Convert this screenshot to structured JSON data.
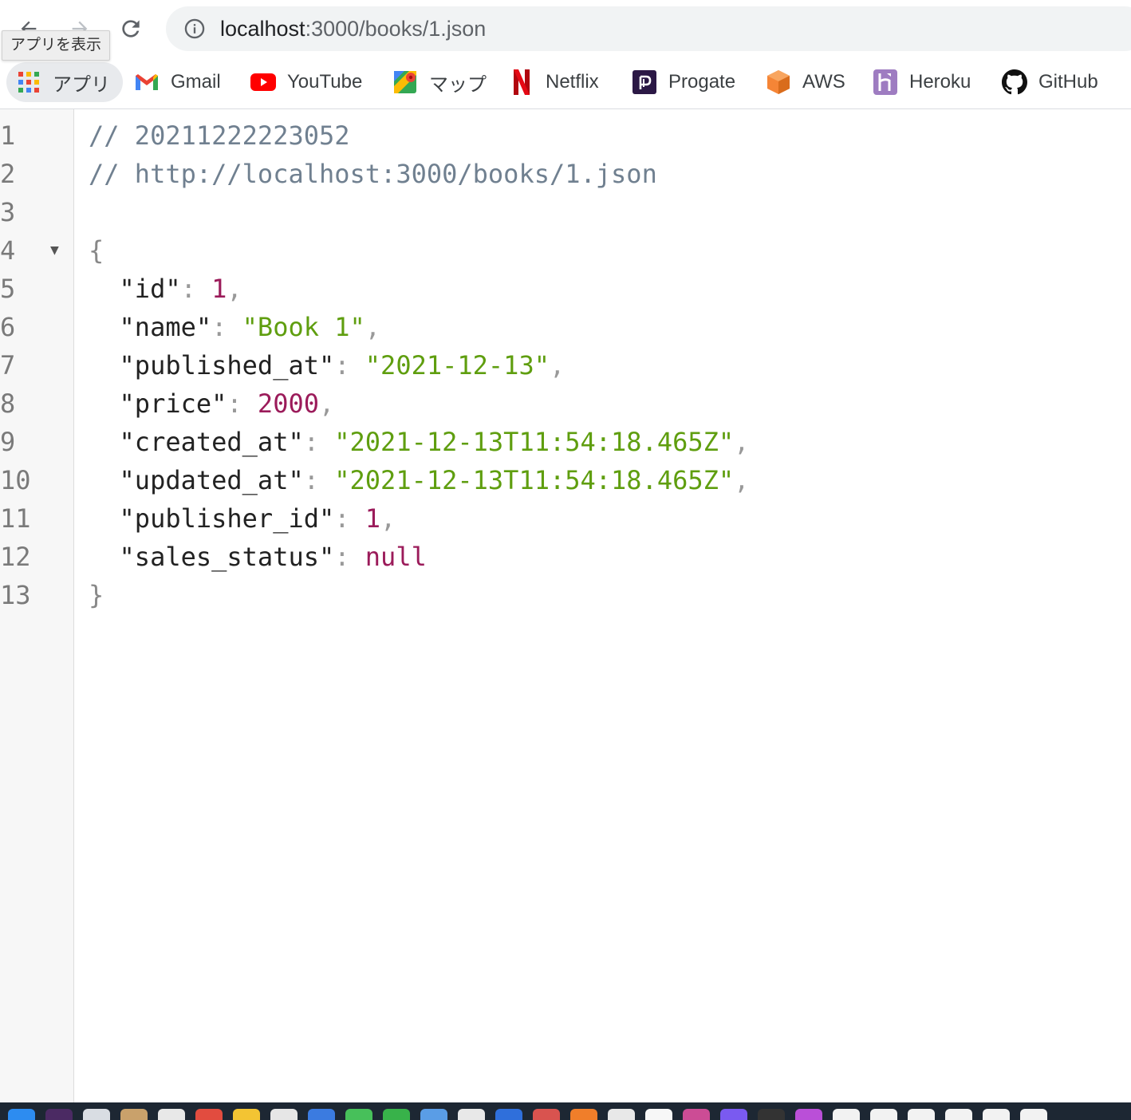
{
  "browser": {
    "tooltip": "アプリを表示",
    "url": {
      "host": "localhost",
      "rest": ":3000/books/1.json"
    }
  },
  "bookmarks": [
    {
      "label": "アプリ",
      "icon": "apps-grid-icon"
    },
    {
      "label": "Gmail",
      "icon": "gmail-icon"
    },
    {
      "label": "YouTube",
      "icon": "youtube-icon"
    },
    {
      "label": "マップ",
      "icon": "maps-icon"
    },
    {
      "label": "Netflix",
      "icon": "netflix-icon"
    },
    {
      "label": "Progate",
      "icon": "progate-icon"
    },
    {
      "label": "AWS",
      "icon": "aws-icon"
    },
    {
      "label": "Heroku",
      "icon": "heroku-icon"
    },
    {
      "label": "GitHub",
      "icon": "github-icon"
    }
  ],
  "viewer": {
    "line_numbers": [
      "1",
      "2",
      "3",
      "4",
      "5",
      "6",
      "7",
      "8",
      "9",
      "10",
      "11",
      "12",
      "13"
    ],
    "comment_timestamp": "// 20211222223052",
    "comment_url": "// http://localhost:3000/books/1.json",
    "open_brace": "{",
    "close_brace": "}",
    "fields": [
      {
        "key": "\"id\"",
        "value": "1",
        "type": "number",
        "trail": ","
      },
      {
        "key": "\"name\"",
        "value": "\"Book 1\"",
        "type": "string",
        "trail": ","
      },
      {
        "key": "\"published_at\"",
        "value": "\"2021-12-13\"",
        "type": "string",
        "trail": ","
      },
      {
        "key": "\"price\"",
        "value": "2000",
        "type": "number",
        "trail": ","
      },
      {
        "key": "\"created_at\"",
        "value": "\"2021-12-13T11:54:18.465Z\"",
        "type": "string",
        "trail": ","
      },
      {
        "key": "\"updated_at\"",
        "value": "\"2021-12-13T11:54:18.465Z\"",
        "type": "string",
        "trail": ","
      },
      {
        "key": "\"publisher_id\"",
        "value": "1",
        "type": "number",
        "trail": ","
      },
      {
        "key": "\"sales_status\"",
        "value": "null",
        "type": "null",
        "trail": ""
      }
    ]
  },
  "colors": {
    "string": "#5f9e0f",
    "number": "#9b1b5a",
    "comment": "#708090"
  }
}
